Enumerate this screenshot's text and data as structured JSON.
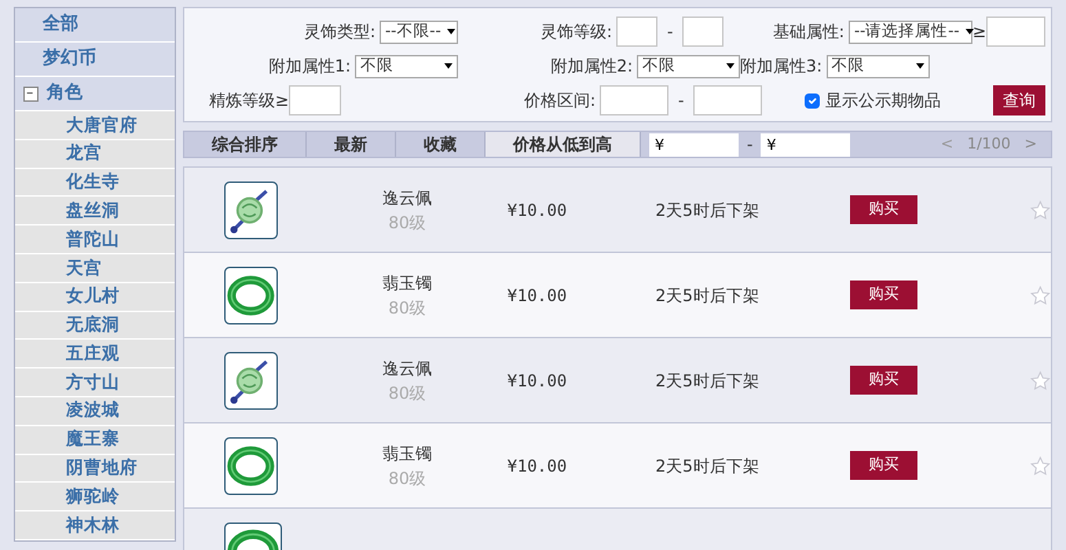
{
  "sidebar": {
    "items": [
      {
        "label": "全部",
        "expanded": false
      },
      {
        "label": "梦幻币",
        "expanded": false
      },
      {
        "label": "角色",
        "expanded": true,
        "children": [
          {
            "label": "大唐官府"
          },
          {
            "label": "龙宫"
          },
          {
            "label": "化生寺"
          },
          {
            "label": "盘丝洞"
          },
          {
            "label": "普陀山"
          },
          {
            "label": "天宫"
          },
          {
            "label": "女儿村"
          },
          {
            "label": "无底洞"
          },
          {
            "label": "五庄观"
          },
          {
            "label": "方寸山"
          },
          {
            "label": "凌波城"
          },
          {
            "label": "魔王寨"
          },
          {
            "label": "阴曹地府"
          },
          {
            "label": "狮驼岭"
          },
          {
            "label": "神木林"
          }
        ]
      }
    ]
  },
  "filters": {
    "fields": [
      {
        "kind": "select",
        "label": "灵饰类型:",
        "value": "--不限--"
      },
      {
        "kind": "range",
        "label": "灵饰等级:",
        "separator": "-"
      },
      {
        "kind": "select_min",
        "label": "基础属性:",
        "value": "--请选择属性--",
        "sign": "≥"
      },
      {
        "kind": "select",
        "label": "附加属性1:",
        "value": "不限"
      },
      {
        "kind": "select",
        "label": "附加属性2:",
        "value": "不限"
      },
      {
        "kind": "select",
        "label": "附加属性3:",
        "value": "不限"
      },
      {
        "kind": "min",
        "label": "精炼等级≥"
      },
      {
        "kind": "range",
        "label": "价格区间:",
        "separator": "-"
      }
    ],
    "show_public": {
      "label": "显示公示期物品",
      "checked": true
    },
    "query_button": "查询"
  },
  "sort_tabs": [
    {
      "label": "综合排序",
      "selected": false
    },
    {
      "label": "最新",
      "selected": false
    },
    {
      "label": "收藏",
      "selected": false
    },
    {
      "label": "价格从低到高",
      "selected": true
    }
  ],
  "price_filter": {
    "min_value": "¥",
    "dash": "-",
    "max_value": "¥"
  },
  "pager": {
    "prev": "<",
    "page": "1/100",
    "next": ">"
  },
  "items": [
    {
      "kind": "pendant",
      "name": "逸云佩",
      "level": "80级",
      "price": "¥10.00",
      "time_left": "2天5时后下架",
      "button": "购买",
      "favorited": false
    },
    {
      "kind": "bracelet",
      "name": "翡玉镯",
      "level": "80级",
      "price": "¥10.00",
      "time_left": "2天5时后下架",
      "button": "购买",
      "favorited": false
    },
    {
      "kind": "pendant",
      "name": "逸云佩",
      "level": "80级",
      "price": "¥10.00",
      "time_left": "2天5时后下架",
      "button": "购买",
      "favorited": false
    },
    {
      "kind": "bracelet",
      "name": "翡玉镯",
      "level": "80级",
      "price": "¥10.00",
      "time_left": "2天5时后下架",
      "button": "购买",
      "favorited": false
    },
    {
      "kind": "bracelet"
    }
  ]
}
